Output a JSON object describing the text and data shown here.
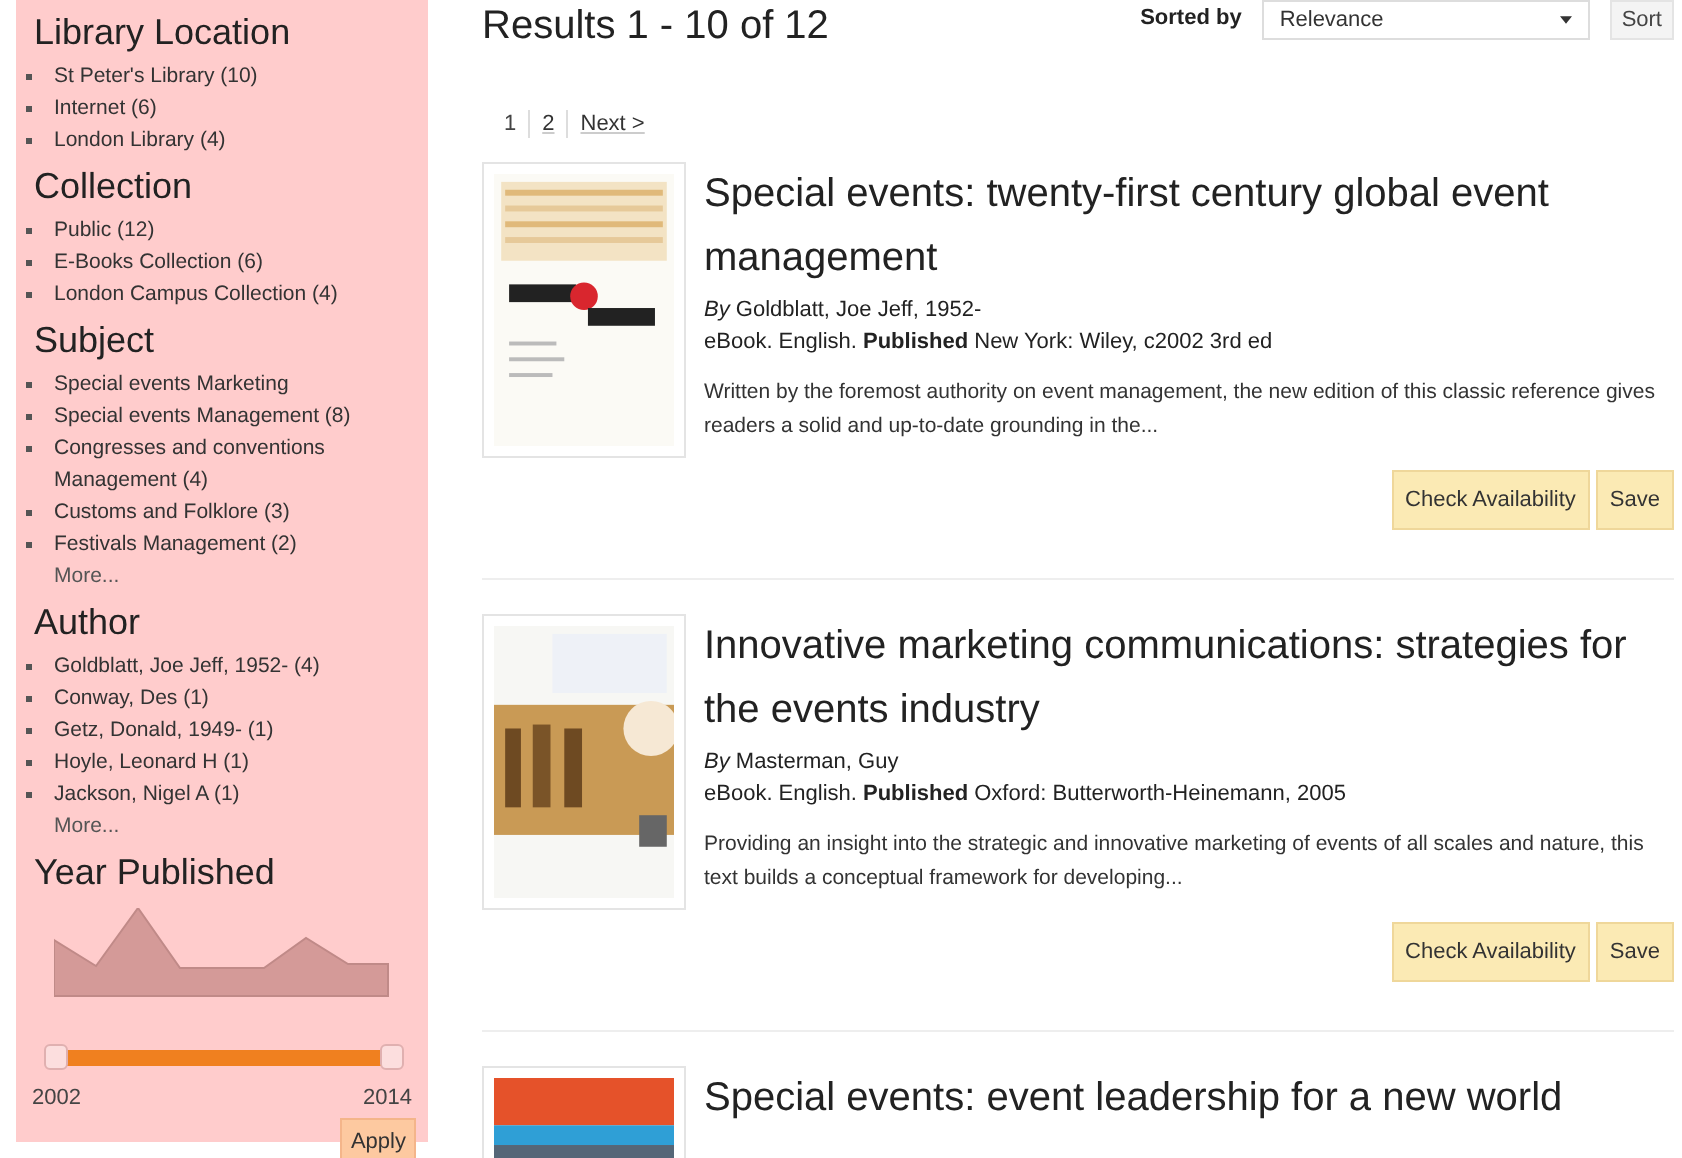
{
  "facets": [
    {
      "title": "Library Location",
      "items": [
        "St Peter's Library (10)",
        "Internet (6)",
        "London Library (4)"
      ]
    },
    {
      "title": "Collection",
      "items": [
        "Public (12)",
        "E-Books Collection (6)",
        "London Campus Collection (4)"
      ]
    },
    {
      "title": "Subject",
      "items": [
        "Special events Marketing",
        "Special events Management (8)",
        "Congresses and conventions Management (4)",
        "Customs and Folklore (3)",
        "Festivals Management (2)"
      ],
      "more": "More..."
    },
    {
      "title": "Author",
      "items": [
        "Goldblatt, Joe Jeff, 1952- (4)",
        "Conway, Des (1)",
        "Getz, Donald, 1949- (1)",
        "Hoyle, Leonard H (1)",
        "Jackson, Nigel A (1)"
      ],
      "more": "More..."
    }
  ],
  "year_filter": {
    "title": "Year Published",
    "low": {
      "level": 0
    },
    "high": {
      "level": 1
    },
    "min_label": "2002",
    "max_label": "2014",
    "apply": "Apply"
  },
  "results_heading": "Results 1 - 10 of 12",
  "sort": {
    "label": "Sorted by",
    "value": "Relevance",
    "button": "Sort"
  },
  "pages": [
    {
      "label": "1",
      "selected": true
    },
    {
      "label": "2",
      "selected": false
    },
    {
      "label": "Next >",
      "selected": false
    }
  ],
  "results": [
    {
      "cover": {
        "kind": "picture"
      },
      "title": "Special events: twenty-first century global event management",
      "by": "By",
      "author": "Goldblatt, Joe Jeff, 1952-",
      "format": "eBook. English.",
      "published_label": "Published",
      "published": "New York: Wiley, c2002 3rd ed",
      "summary": "Written by the foremost authority on event management, the new edition of this classic reference gives readers a solid and up-to-date grounding in the...",
      "buttons": [
        "Check Availability",
        "Save"
      ]
    },
    {
      "cover": {
        "kind": "picture"
      },
      "title": "Innovative marketing communications: strategies for the events industry",
      "by": "By",
      "author": "Masterman, Guy",
      "format": "eBook. English.",
      "published_label": "Published",
      "published": "Oxford: Butterworth-Heinemann, 2005",
      "summary": "Providing an insight into the strategic and innovative marketing of events of all scales and nature, this text builds a conceptual framework for developing...",
      "buttons": [
        "Check Availability",
        "Save"
      ]
    },
    {
      "cover": {
        "kind": "picture"
      },
      "title": "Special events: event leadership for a new world"
    }
  ]
}
